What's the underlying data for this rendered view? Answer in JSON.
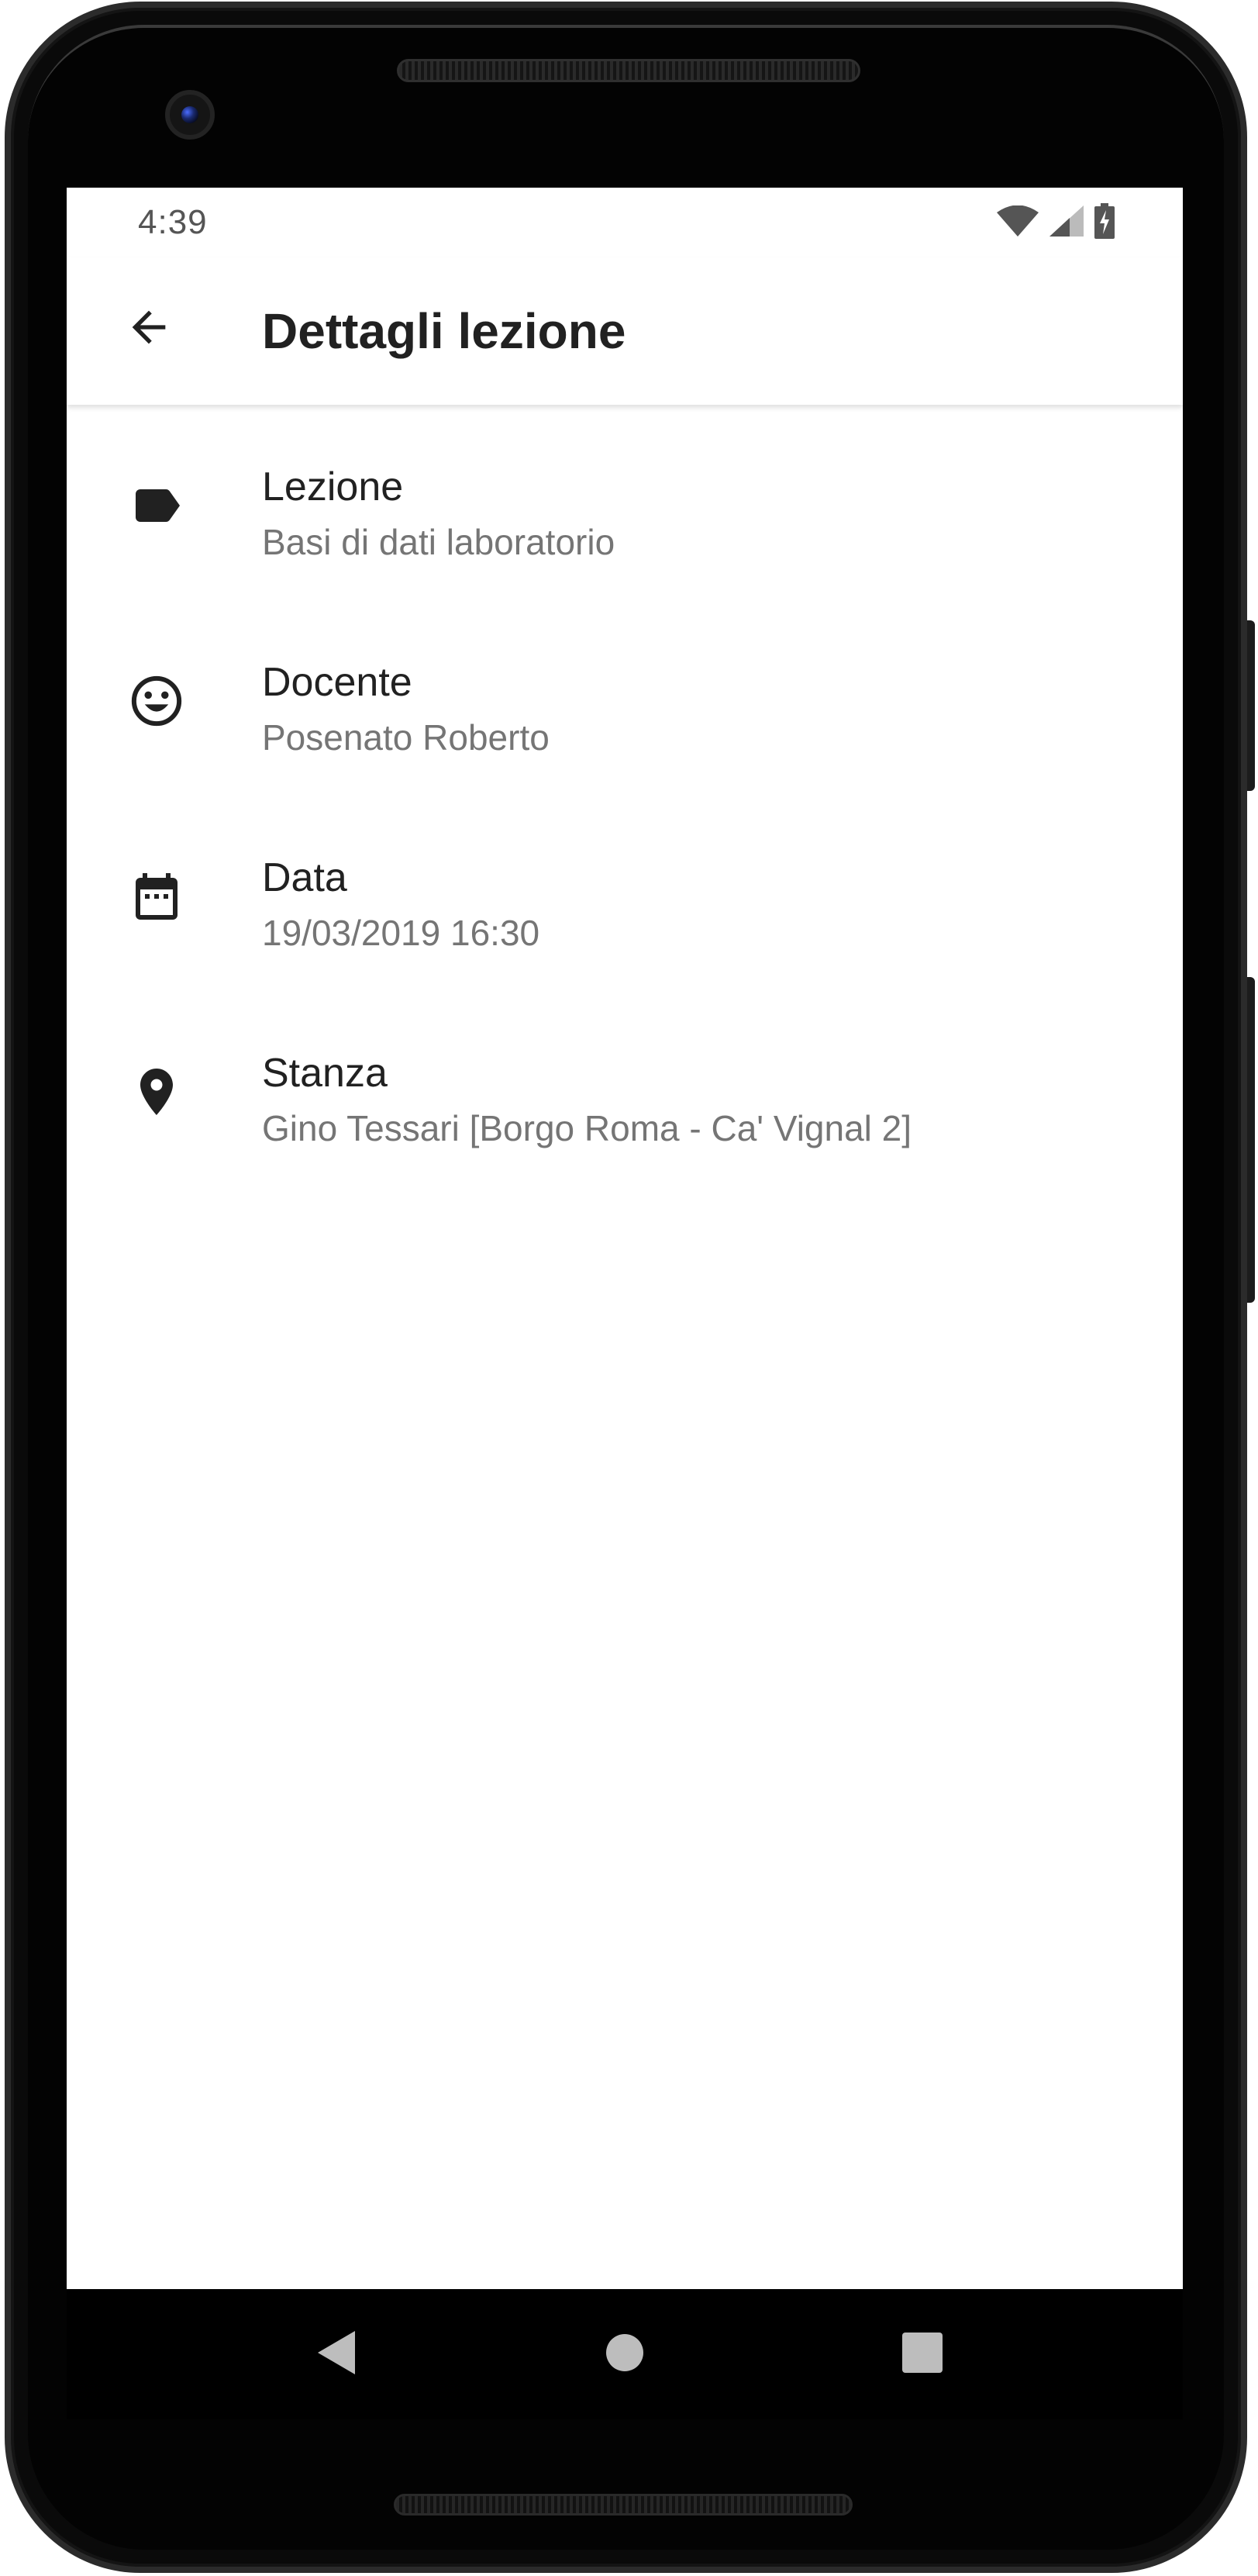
{
  "status_bar": {
    "time": "4:39",
    "icons": [
      "wifi-icon",
      "signal-icon",
      "battery-charging-icon"
    ]
  },
  "app_bar": {
    "title": "Dettagli lezione",
    "back_icon": "arrow-back-icon"
  },
  "details": [
    {
      "icon": "label-icon",
      "title": "Lezione",
      "value": "Basi di dati laboratorio"
    },
    {
      "icon": "face-icon",
      "title": "Docente",
      "value": "Posenato Roberto"
    },
    {
      "icon": "calendar-icon",
      "title": "Data",
      "value": "19/03/2019 16:30"
    },
    {
      "icon": "location-pin-icon",
      "title": "Stanza",
      "value": "Gino Tessari [Borgo Roma - Ca' Vignal 2]"
    }
  ],
  "navigation": {
    "buttons": [
      "back-triangle-icon",
      "home-circle-icon",
      "recents-square-icon"
    ]
  },
  "colors": {
    "primary_text": "#212121",
    "secondary_text": "#757575",
    "icon": "#212121",
    "status_text": "#555555",
    "nav_bar": "#000000"
  }
}
